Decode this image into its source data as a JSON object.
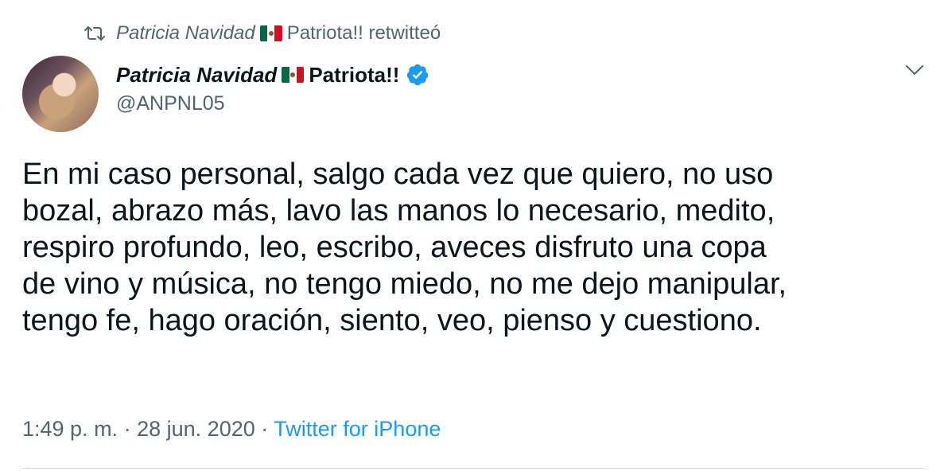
{
  "retweet": {
    "icon": "retweet-icon",
    "retweeter_name": "Patricia Navidad",
    "retweeter_suffix": "Patriota!!",
    "action": "retwitteó",
    "flag_icon": "mexico-flag-icon"
  },
  "author": {
    "display_name": "Patricia Navidad",
    "name_suffix": "Patriota!!",
    "handle": "@ANPNL05",
    "verified_icon": "verified-badge-icon",
    "flag_icon": "mexico-flag-icon"
  },
  "menu": {
    "icon": "chevron-down-icon"
  },
  "tweet": {
    "lines": [
      "En mi caso personal, salgo cada vez que quiero, no uso",
      "bozal, abrazo más, lavo las manos lo necesario, medito,",
      "respiro profundo, leo, escribo, aveces disfruto una copa",
      "de vino y música, no tengo miedo, no me dejo manipular,",
      "tengo fe, hago oración, siento, veo, pienso y cuestiono."
    ]
  },
  "meta": {
    "time": "1:49 p. m.",
    "separator": "·",
    "date": "28 jun. 2020",
    "source": "Twitter for iPhone"
  },
  "colors": {
    "text": "#0f1419",
    "secondary": "#536471",
    "link": "#1d9bf0",
    "verified": "#1d9bf0"
  }
}
